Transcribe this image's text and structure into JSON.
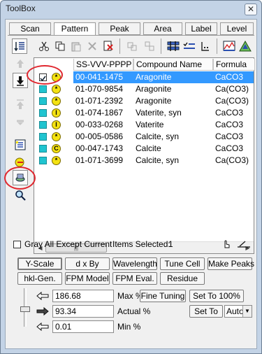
{
  "window": {
    "title": "ToolBox",
    "close": "✕"
  },
  "tabs": [
    "Scan",
    "Pattern",
    "Peak",
    "Area",
    "Label",
    "Level"
  ],
  "active_tab": "Pattern",
  "list": {
    "columns": [
      "SS-VVV-PPPP",
      "Compound Name",
      "Formula"
    ],
    "rows": [
      {
        "code": "00-041-1475",
        "name": "Aragonite",
        "formula": "CaCO3",
        "badge": "*"
      },
      {
        "code": "01-070-9854",
        "name": "Aragonite",
        "formula": "Ca(CO3)",
        "badge": "*"
      },
      {
        "code": "01-071-2392",
        "name": "Aragonite",
        "formula": "Ca(CO3)",
        "badge": "*"
      },
      {
        "code": "01-074-1867",
        "name": "Vaterite, syn",
        "formula": "CaCO3",
        "badge": "I"
      },
      {
        "code": "00-033-0268",
        "name": "Vaterite",
        "formula": "CaCO3",
        "badge": "I"
      },
      {
        "code": "00-005-0586",
        "name": "Calcite, syn",
        "formula": "CaCO3",
        "badge": "*"
      },
      {
        "code": "00-047-1743",
        "name": "Calcite",
        "formula": "CaCO3",
        "badge": "C"
      },
      {
        "code": "01-071-3699",
        "name": "Calcite, syn",
        "formula": "Ca(CO3)",
        "badge": "*"
      }
    ],
    "scroll_thumb": "|||"
  },
  "status": {
    "gray_all_label": "Gray All Except Current",
    "items_selected_label": "Items Selected:",
    "items_selected_value": "1"
  },
  "action_buttons": [
    "Y-Scale",
    "d x By",
    "Wavelength",
    "Tune Cell",
    "Make Peaks",
    "hkl-Gen.",
    "FPM Model",
    "FPM Eval.",
    "Residue"
  ],
  "scale": {
    "max_value": "186.68",
    "max_label": "Max %",
    "actual_value": "93.34",
    "actual_label": "Actual %",
    "min_value": "0.01",
    "min_label": "Min %",
    "fine_tuning": "Fine Tuning",
    "set_to_100": "Set To 100%",
    "set_to": "Set To",
    "auto_option": "Auto"
  },
  "colors": {
    "selection": "#3399ff",
    "annotation": "#e0272f",
    "badge": "#f4e212",
    "cyan_box": "#20c4d0"
  }
}
